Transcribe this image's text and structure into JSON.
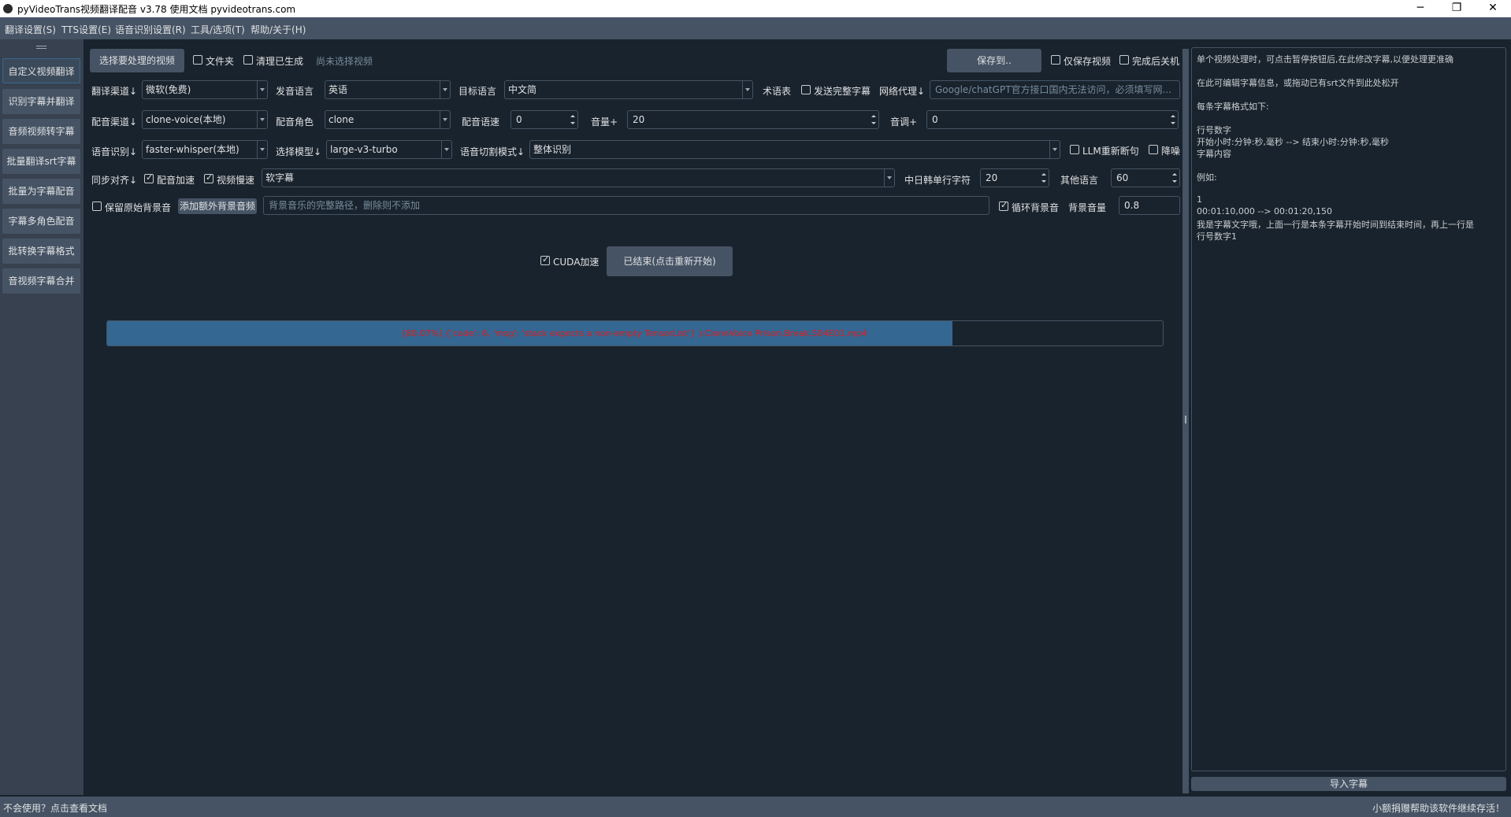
{
  "window": {
    "title": "pyVideoTrans视频翻译配音 v3.78  使用文档  pyvideotrans.com",
    "controls": {
      "minimize": "─",
      "restore": "❐",
      "close": "✕"
    }
  },
  "menubar": [
    "翻译设置(S)",
    "TTS设置(E)",
    "语音识别设置(R)",
    "工具/选项(T)",
    "帮助/关于(H)"
  ],
  "sidebar": {
    "items": [
      {
        "label": "自定义视频翻译",
        "active": true
      },
      {
        "label": "识别字幕并翻译"
      },
      {
        "label": "音频视频转字幕"
      },
      {
        "label": "批量翻译srt字幕"
      },
      {
        "label": "批量为字幕配音"
      },
      {
        "label": "字幕多角色配音"
      },
      {
        "label": "批转换字幕格式"
      },
      {
        "label": "音视频字幕合并"
      }
    ]
  },
  "toolbar": {
    "select_video": "选择要处理的视频",
    "folder": "文件夹",
    "clear_generated": "清理已生成",
    "no_video": "尚未选择视频",
    "save_to": "保存到..",
    "save_video_only": "仅保存视频",
    "shutdown_after": "完成后关机"
  },
  "row1": {
    "translate_channel_label": "翻译渠道↓",
    "translate_channel": "微软(免费)",
    "source_lang_label": "发音语言",
    "source_lang": "英语",
    "target_lang_label": "目标语言",
    "target_lang": "中文简",
    "glossary": "术语表",
    "send_full_subtitle": "发送完整字幕",
    "proxy_label": "网络代理↓",
    "proxy_placeholder": "Google/chatGPT官方接口国内无法访问，必须填写网..."
  },
  "row2": {
    "dub_channel_label": "配音渠道↓",
    "dub_channel": "clone-voice(本地)",
    "dub_role_label": "配音角色",
    "dub_role": "clone",
    "dub_speed_label": "配音语速",
    "dub_speed": "0",
    "volume_label": "音量+",
    "volume": "20",
    "pitch_label": "音调+",
    "pitch": "0"
  },
  "row3": {
    "asr_label": "语音识别↓",
    "asr": "faster-whisper(本地)",
    "model_label": "选择模型↓",
    "model": "large-v3-turbo",
    "split_mode_label": "语音切割模式↓",
    "split_mode": "整体识别",
    "llm_resplit": "LLM重新断句",
    "denoise": "降噪"
  },
  "row4": {
    "sync_label": "同步对齐↓",
    "dub_accel": "配音加速",
    "video_slow": "视频慢速",
    "subtitle_type": "软字幕",
    "cjk_chars_label": "中日韩单行字符",
    "cjk_chars": "20",
    "other_lang_label": "其他语言",
    "other_lang": "60"
  },
  "row5": {
    "keep_bg": "保留原始背景音",
    "add_bg_audio": "添加额外背景音频",
    "bg_path_placeholder": "背景音乐的完整路径，删除则不添加",
    "loop_bg": "循环背景音",
    "bg_volume_label": "背景音量",
    "bg_volume": "0.8"
  },
  "action": {
    "cuda": "CUDA加速",
    "start_button": "已结束(点击重新开始)"
  },
  "progress": {
    "percent": 80.07,
    "text": "[80.07%]  {'code': 6, 'msg': 'stack expects a non-empty TensorList'} ):CloneVoice   Prison.Break.S04E01.mp4"
  },
  "subtitle_panel": {
    "lines": [
      "单个视频处理时，可点击暂停按钮后,在此修改字幕,以便处理更准确",
      "",
      " 在此可编辑字幕信息，或拖动已有srt文件到此处松开",
      "",
      "每条字幕格式如下:",
      "",
      "行号数字",
      "开始小时:分钟:秒,毫秒 --> 结束小时:分钟:秒,毫秒",
      "字幕内容",
      "",
      "例如:",
      "",
      "1",
      "00:01:10,000 --> 00:01:20,150",
      "我是字幕文字哦，上面一行是本条字幕开始时间到结束时间，再上一行是",
      "行号数字1"
    ],
    "import_button": "导入字幕"
  },
  "statusbar": {
    "left": "不会使用？点击查看文档",
    "right": "小额捐赠帮助该软件继续存活！"
  }
}
